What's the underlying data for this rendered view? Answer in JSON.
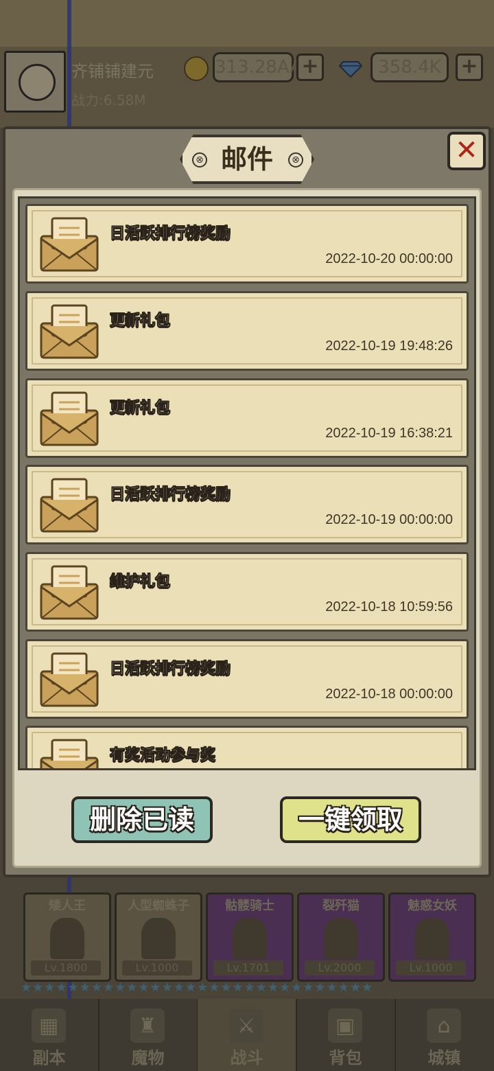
{
  "player": {
    "name": "齐铺铺建元",
    "power": "战力:6.58M"
  },
  "currency": {
    "gold": "313.28AA",
    "gems": "358.4K",
    "plus": "+"
  },
  "modal": {
    "title": "邮件",
    "title_ornament": "⊗",
    "close_glyph": "✕",
    "mails": [
      {
        "title": "日活跃排行榜奖励",
        "time": "2022-10-20 00:00:00"
      },
      {
        "title": "更新礼包",
        "time": "2022-10-19 19:48:26"
      },
      {
        "title": "更新礼包",
        "time": "2022-10-19 16:38:21"
      },
      {
        "title": "日活跃排行榜奖励",
        "time": "2022-10-19 00:00:00"
      },
      {
        "title": "维护礼包",
        "time": "2022-10-18 10:59:56"
      },
      {
        "title": "日活跃排行榜奖励",
        "time": "2022-10-18 00:00:00"
      },
      {
        "title": "有奖活动参与奖",
        "time": ""
      }
    ],
    "delete_read_label": "删除已读",
    "claim_all_label": "一键领取"
  },
  "monsters": [
    {
      "name": "矮人王",
      "lv": "Lv.1800",
      "style": "brown"
    },
    {
      "name": "人型蜘蛛子",
      "lv": "Lv.1000",
      "style": "brown"
    },
    {
      "name": "骷髅骑士",
      "lv": "Lv.1701",
      "style": "purple"
    },
    {
      "name": "裂歼猫",
      "lv": "Lv.2000",
      "style": "purple"
    },
    {
      "name": "魅惑女妖",
      "lv": "Lv.1000",
      "style": "purple"
    }
  ],
  "nav": [
    {
      "label": "副本",
      "icon": "map-icon",
      "glyph": "▦"
    },
    {
      "label": "魔物",
      "icon": "monster-icon",
      "glyph": "♜"
    },
    {
      "label": "战斗",
      "icon": "swords-icon",
      "glyph": "⚔"
    },
    {
      "label": "背包",
      "icon": "backpack-icon",
      "glyph": "▣"
    },
    {
      "label": "城镇",
      "icon": "town-icon",
      "glyph": "⌂"
    }
  ],
  "stars": "★★★★★★★★★★★★★★★★★★★★★★★★★★★★★★",
  "colors": {
    "accent_close": "#b02418",
    "delete_button": "#8fc3b6",
    "claim_button": "#dfe28a",
    "mail_bg": "#eadfb6"
  }
}
